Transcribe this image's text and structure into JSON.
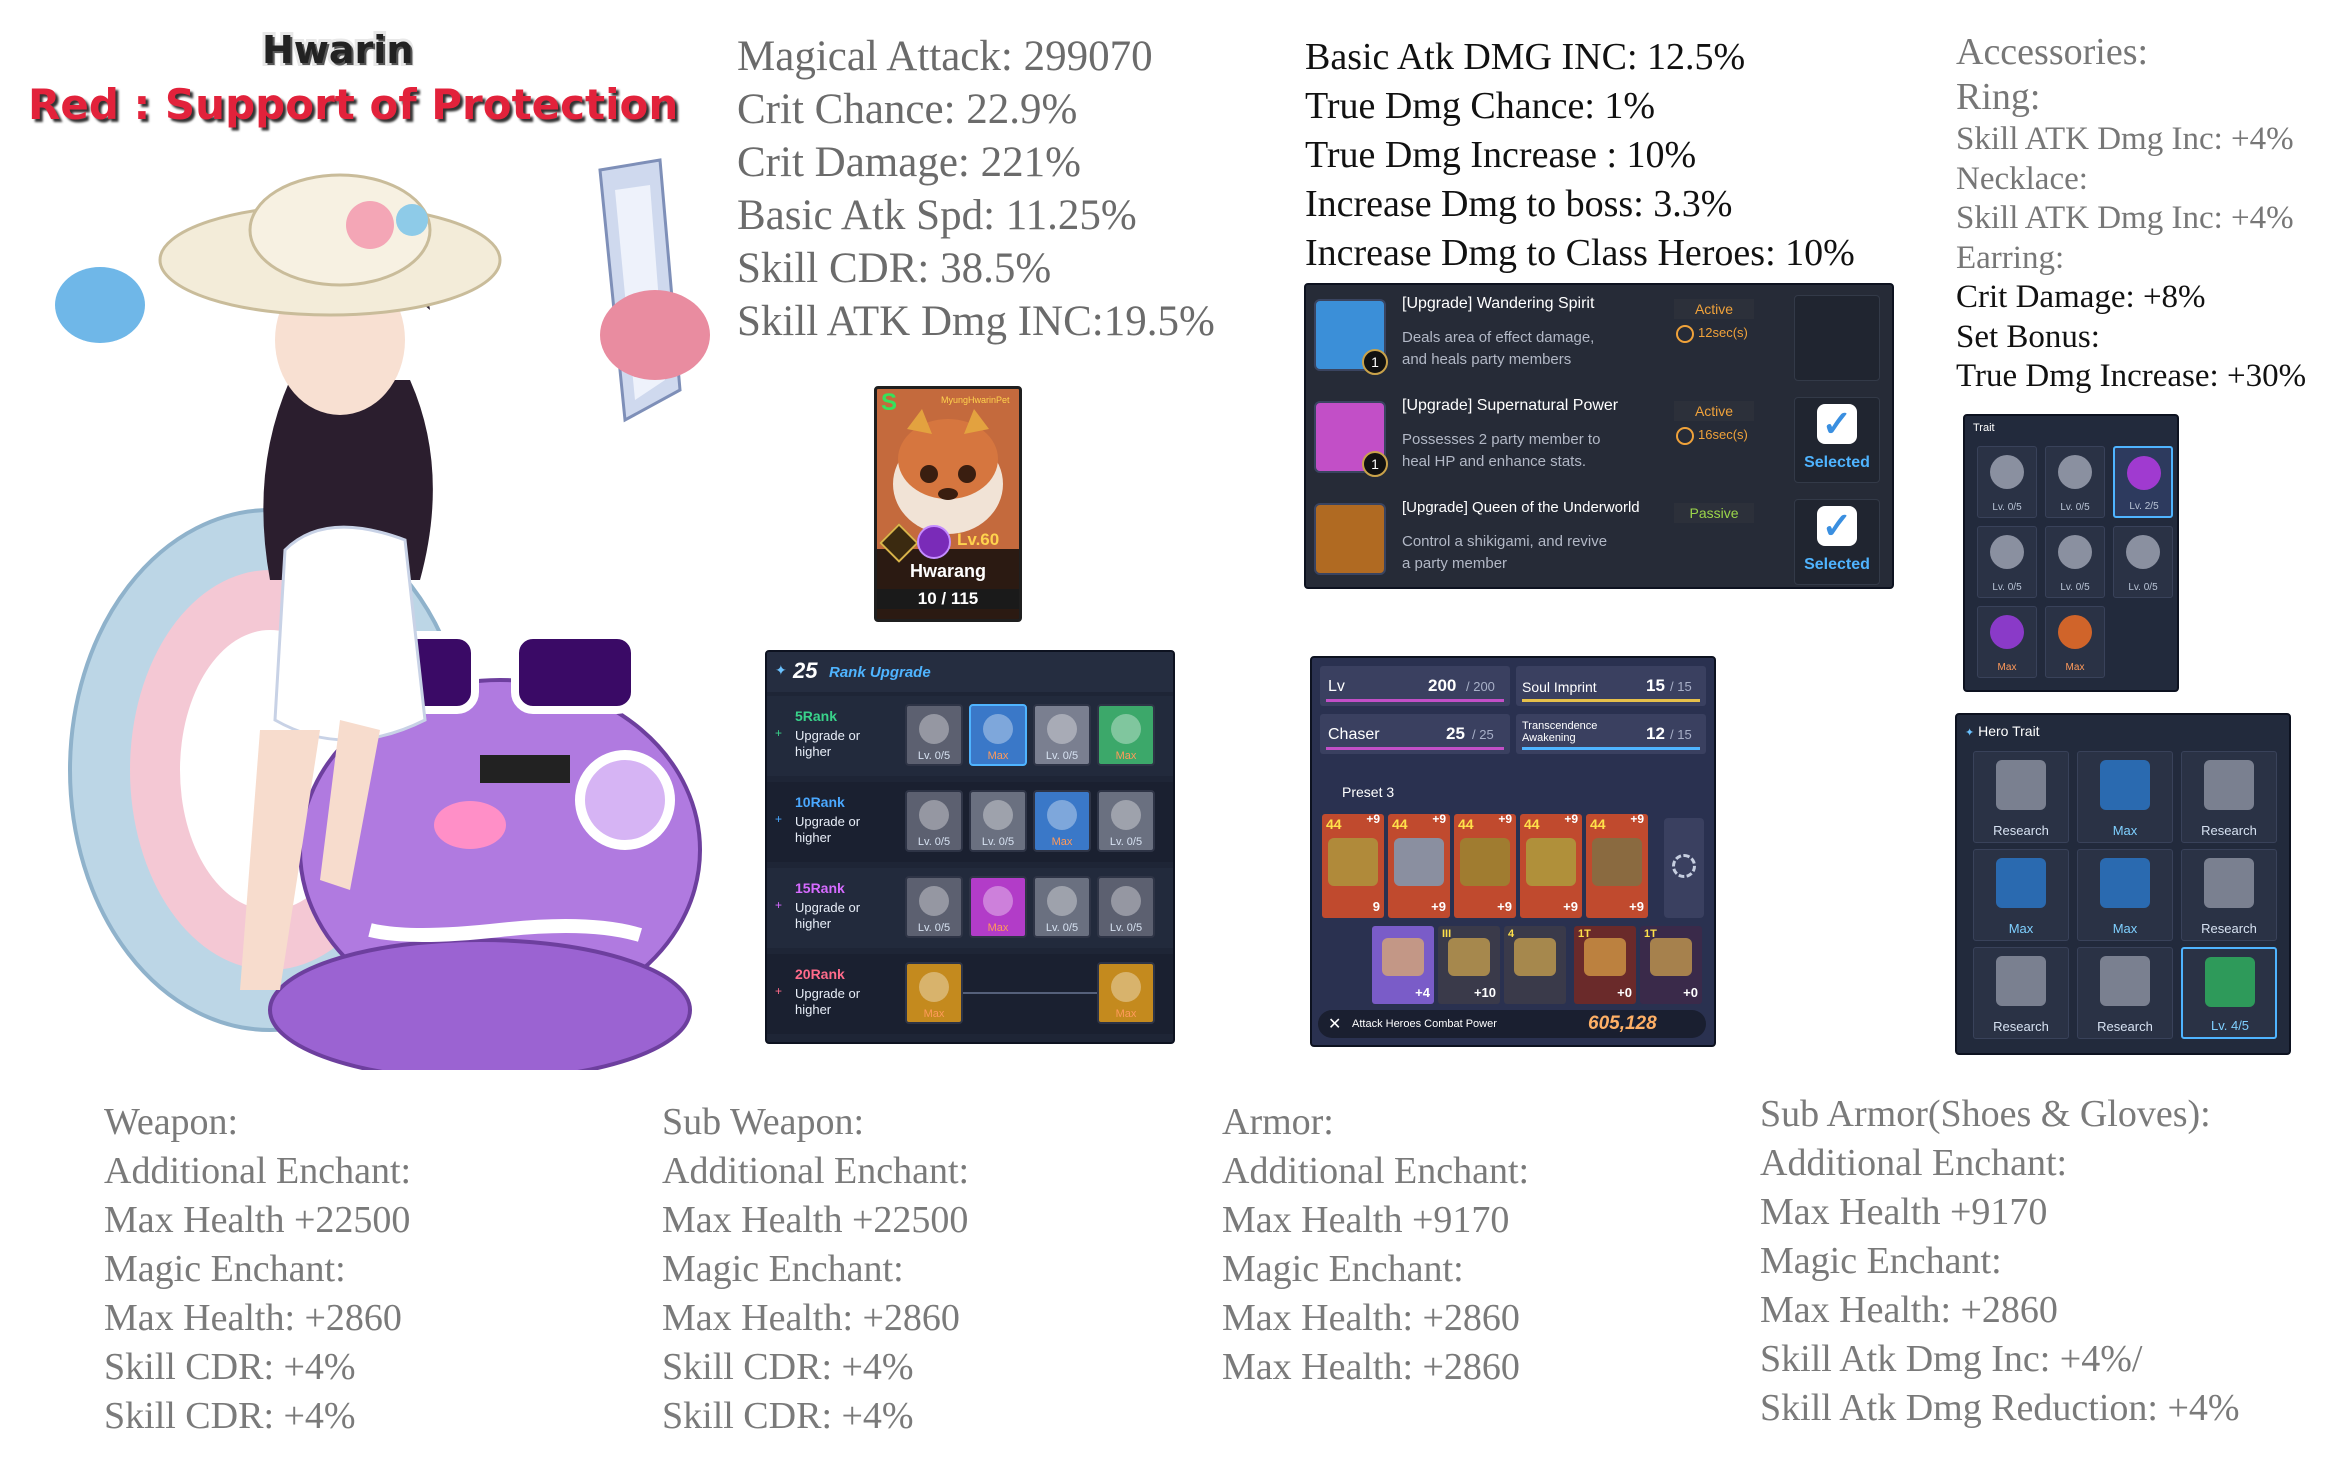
{
  "title": {
    "name": "Hwarin",
    "role": "Red : Support of Protection"
  },
  "stats_left": [
    "Magical Attack: 299070",
    "Crit Chance: 22.9%",
    "Crit Damage: 221%",
    "Basic Atk Spd: 11.25%",
    "Skill CDR: 38.5%",
    "Skill ATK Dmg INC:19.5%"
  ],
  "stats_right": [
    "Basic Atk DMG INC: 12.5%",
    "True Dmg Chance: 1%",
    "True Dmg Increase : 10%",
    "Increase Dmg to boss: 3.3%",
    "Increase Dmg to Class Heroes: 10%"
  ],
  "accessories": [
    "Accessories:",
    "Ring:",
    "Skill ATK Dmg Inc: +4%",
    "Necklace:",
    "Skill ATK Dmg Inc: +4%",
    "Earring:",
    "Crit Damage: +8%",
    "Set Bonus:",
    "True Dmg Increase: +30%"
  ],
  "pet": {
    "grade": "S",
    "tag": "MyungHwarinPet",
    "level": "Lv.60",
    "name": "Hwarang",
    "count": "10 / 115"
  },
  "skills": [
    {
      "name": "[Upgrade] Wandering Spirit",
      "type": "Active",
      "cooldown": "12sec(s)",
      "desc1": "Deals area of effect damage,",
      "desc2": "and heals party members",
      "level": "1",
      "status": ""
    },
    {
      "name": "[Upgrade] Supernatural Power",
      "type": "Active",
      "cooldown": "16sec(s)",
      "desc1": "Possesses 2 party member to",
      "desc2": "heal HP and enhance stats.",
      "level": "1",
      "status": "Selected"
    },
    {
      "name": "[Upgrade] Queen of the Underworld",
      "type": "Passive",
      "cooldown": "",
      "desc1": "Control a shikigami, and revive",
      "desc2": "a party member",
      "level": "",
      "status": "Selected"
    }
  ],
  "rank_upgrade": {
    "count": "25",
    "title": "Rank Upgrade",
    "rows": [
      {
        "rank": "5Rank",
        "sub1": "Upgrade or",
        "sub2": "higher",
        "color": "#39d38a",
        "cells": [
          "Lv. 0/5",
          "Max",
          "Lv. 0/5",
          "Max"
        ]
      },
      {
        "rank": "10Rank",
        "sub1": "Upgrade or",
        "sub2": "higher",
        "color": "#4aa8ff",
        "cells": [
          "Lv. 0/5",
          "Lv. 0/5",
          "Max",
          "Lv. 0/5"
        ]
      },
      {
        "rank": "15Rank",
        "sub1": "Upgrade or",
        "sub2": "higher",
        "color": "#d66bff",
        "cells": [
          "Lv. 0/5",
          "Max",
          "Lv. 0/5",
          "Lv. 0/5"
        ]
      },
      {
        "rank": "20Rank",
        "sub1": "Upgrade or",
        "sub2": "higher",
        "color": "#ff6b8a",
        "cells": [
          "Max",
          "",
          "",
          "Max"
        ]
      }
    ]
  },
  "equipment": {
    "lv_label": "Lv",
    "lv_value": "200",
    "lv_max": "/ 200",
    "soul_label": "Soul Imprint",
    "soul_value": "15",
    "soul_max": "/ 15",
    "class_label": "Chaser",
    "class_value": "25",
    "class_max": "/ 25",
    "trans_label1": "Transcendence",
    "trans_label2": "Awakening",
    "trans_value": "12",
    "trans_max": "/ 15",
    "preset": "Preset 3",
    "top_levels": [
      "44",
      "44",
      "44",
      "44",
      "44"
    ],
    "top_plus_top": [
      "+9",
      "+9",
      "+9",
      "+9",
      "+9"
    ],
    "top_bottom": [
      "9",
      "+9",
      "+9",
      "+9",
      "+9"
    ],
    "bottom_tags": [
      "",
      "III",
      "4",
      "1T",
      "1T"
    ],
    "bottom_values": [
      "+4",
      "+10",
      "",
      "+0",
      "+0"
    ],
    "power_label": "Attack Heroes Combat Power",
    "power_value": "605,128"
  },
  "trait": {
    "title": "Trait",
    "cells": [
      "Lv. 0/5",
      "Lv. 0/5",
      "Lv. 2/5",
      "Lv. 0/5",
      "Lv. 0/5",
      "Lv. 0/5",
      "Max",
      "Max"
    ]
  },
  "hero_trait": {
    "title": "Hero Trait",
    "cells": [
      "Research",
      "Max",
      "Research",
      "Max",
      "Max",
      "Research",
      "Research",
      "Research",
      "Lv. 4/5"
    ]
  },
  "gear": [
    [
      "Weapon:",
      "Additional Enchant:",
      "Max Health +22500",
      "Magic Enchant:",
      "Max Health: +2860",
      "Skill CDR: +4%",
      "Skill CDR: +4%"
    ],
    [
      "Sub Weapon:",
      "Additional Enchant:",
      "Max Health +22500",
      "Magic Enchant:",
      "Max Health: +2860",
      "Skill CDR: +4%",
      "Skill CDR: +4%"
    ],
    [
      "Armor:",
      "Additional Enchant:",
      "Max Health +9170",
      "Magic Enchant:",
      "Max Health: +2860",
      "Max Health: +2860"
    ],
    [
      "Sub Armor(Shoes & Gloves):",
      "Additional Enchant:",
      "Max Health +9170",
      "Magic Enchant:",
      "Max Health: +2860",
      "Skill Atk Dmg Inc: +4%/",
      "Skill Atk Dmg Reduction: +4%"
    ]
  ],
  "colors": {
    "accent": "#e2223b",
    "panel": "#1e2536",
    "selected": "#3aa0ff",
    "power": "#ffb066"
  }
}
